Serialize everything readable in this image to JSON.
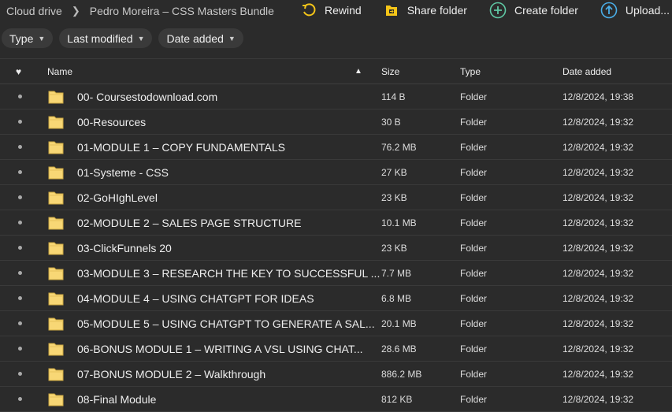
{
  "breadcrumb": {
    "root": "Cloud drive",
    "current": "Pedro Moreira – CSS Masters Bundle"
  },
  "actions": {
    "rewind": "Rewind",
    "share": "Share folder",
    "create": "Create folder",
    "upload": "Upload..."
  },
  "filters": [
    "Type",
    "Last modified",
    "Date added"
  ],
  "columns": {
    "name": "Name",
    "size": "Size",
    "type": "Type",
    "date": "Date added"
  },
  "colors": {
    "folder": "#f8d775",
    "rewind": "#f5c518",
    "create": "#5fc8a4",
    "upload": "#4aaee8"
  },
  "rows": [
    {
      "name": "00- Coursestodownload.com",
      "size": "114 B",
      "type": "Folder",
      "date": "12/8/2024, 19:38"
    },
    {
      "name": "00-Resources",
      "size": "30 B",
      "type": "Folder",
      "date": "12/8/2024, 19:32"
    },
    {
      "name": "01-MODULE 1 – COPY FUNDAMENTALS",
      "size": "76.2 MB",
      "type": "Folder",
      "date": "12/8/2024, 19:32"
    },
    {
      "name": "01-Systeme - CSS",
      "size": "27 KB",
      "type": "Folder",
      "date": "12/8/2024, 19:32"
    },
    {
      "name": "02-GoHIghLevel",
      "size": "23 KB",
      "type": "Folder",
      "date": "12/8/2024, 19:32"
    },
    {
      "name": "02-MODULE 2 – SALES PAGE STRUCTURE",
      "size": "10.1 MB",
      "type": "Folder",
      "date": "12/8/2024, 19:32"
    },
    {
      "name": "03-ClickFunnels 20",
      "size": "23 KB",
      "type": "Folder",
      "date": "12/8/2024, 19:32"
    },
    {
      "name": "03-MODULE 3 – RESEARCH THE KEY TO SUCCESSFUL ...",
      "size": "7.7 MB",
      "type": "Folder",
      "date": "12/8/2024, 19:32"
    },
    {
      "name": "04-MODULE 4 – USING CHATGPT FOR IDEAS",
      "size": "6.8 MB",
      "type": "Folder",
      "date": "12/8/2024, 19:32"
    },
    {
      "name": "05-MODULE 5 – USING CHATGPT TO GENERATE A SAL...",
      "size": "20.1 MB",
      "type": "Folder",
      "date": "12/8/2024, 19:32"
    },
    {
      "name": "06-BONUS MODULE 1 – WRITING A VSL USING CHAT...",
      "size": "28.6 MB",
      "type": "Folder",
      "date": "12/8/2024, 19:32"
    },
    {
      "name": "07-BONUS MODULE 2 – Walkthrough",
      "size": "886.2 MB",
      "type": "Folder",
      "date": "12/8/2024, 19:32"
    },
    {
      "name": "08-Final Module",
      "size": "812 KB",
      "type": "Folder",
      "date": "12/8/2024, 19:32"
    }
  ]
}
